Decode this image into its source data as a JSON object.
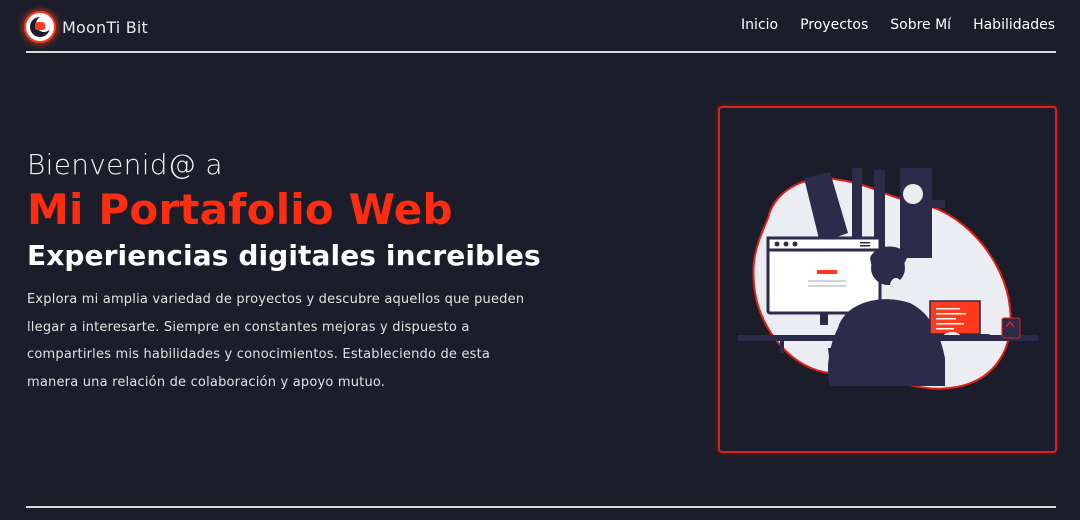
{
  "header": {
    "brand": "MoonTi Bit",
    "nav": [
      {
        "label": "Inicio"
      },
      {
        "label": "Proyectos"
      },
      {
        "label": "Sobre Mí"
      },
      {
        "label": "Habilidades"
      }
    ]
  },
  "hero": {
    "welcome": "Bienvenid@ a",
    "title": "Mi Portafolio Web",
    "subtitle": "Experiencias digitales increibles",
    "description": "Explora mi amplia variedad de proyectos y descubre aquellos que pueden llegar a interesarte. Siempre en constantes mejoras y dispuesto a compartirles mis habilidades y conocimientos. Estableciendo de esta manera una relación de colaboración y apoyo mutuo."
  },
  "colors": {
    "background": "#1b1e2a",
    "accent": "#ff2d10",
    "frame": "#e0201a"
  }
}
